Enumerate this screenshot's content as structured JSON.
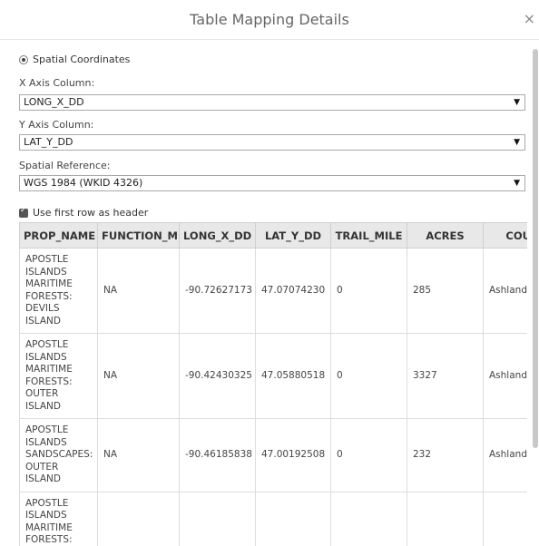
{
  "dialog": {
    "title": "Table Mapping Details",
    "close_icon": "close-icon",
    "close_glyph": "×"
  },
  "spatial": {
    "label": "Spatial Coordinates",
    "selected": true
  },
  "x_axis": {
    "label": "X Axis Column:",
    "value": "LONG_X_DD"
  },
  "y_axis": {
    "label": "Y Axis Column:",
    "value": "LAT_Y_DD"
  },
  "spatial_reference": {
    "label": "Spatial Reference:",
    "value": "WGS 1984 (WKID 4326)"
  },
  "select_caret": "▼",
  "header_row": {
    "label": "Use first row as header",
    "checked": true
  },
  "table": {
    "columns": [
      "PROP_NAME",
      "FUNCTION_M",
      "LONG_X_DD",
      "LAT_Y_DD",
      "TRAIL_MILE",
      "ACRES",
      "COUN"
    ],
    "rows": [
      [
        "APOSTLE\nISLANDS\nMARITIME\nFORESTS:\nDEVILS\nISLAND",
        "NA",
        "-90.72627173",
        "47.07074230",
        "0",
        "285",
        "Ashland"
      ],
      [
        "APOSTLE\nISLANDS\nMARITIME\nFORESTS:\nOUTER\nISLAND",
        "NA",
        "-90.42430325",
        "47.05880518",
        "0",
        "3327",
        "Ashland"
      ],
      [
        "APOSTLE\nISLANDS\nSANDSCAPES:\nOUTER\nISLAND",
        "NA",
        "-90.46185838",
        "47.00192508",
        "0",
        "232",
        "Ashland"
      ],
      [
        "APOSTLE\nISLANDS\nMARITIME\nFORESTS:\n\n",
        "",
        "",
        "",
        "",
        "",
        ""
      ]
    ]
  }
}
